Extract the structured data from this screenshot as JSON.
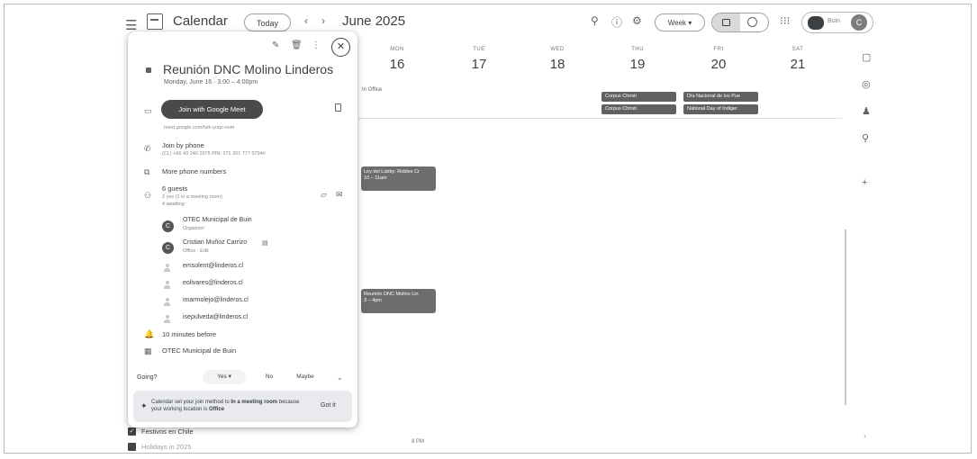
{
  "header": {
    "app_title": "Calendar",
    "today_label": "Today",
    "prev": "‹",
    "next": "›",
    "month": "June 2025",
    "view_label": "Week",
    "org_name": "Buin",
    "avatar_initial": "C"
  },
  "days": [
    {
      "name": "MON",
      "num": "16"
    },
    {
      "name": "TUE",
      "num": "17"
    },
    {
      "name": "WED",
      "num": "18"
    },
    {
      "name": "THU",
      "num": "19"
    },
    {
      "name": "FRI",
      "num": "20"
    },
    {
      "name": "SAT",
      "num": "21"
    }
  ],
  "working_location": "In Office",
  "allday_events": {
    "thu_1": "Corpus Christi",
    "thu_2": "Corpus Christi",
    "fri_1": "Día Nacional de los Pue",
    "fri_2": "National Day of Indiger"
  },
  "events": {
    "e1_title": "Ley del Lobby: Robles Cr",
    "e1_time": "10 – 11am",
    "e2_title": "Reunión DNC Molino Lin",
    "e2_time": "3 – 4pm"
  },
  "grid": {
    "bottom_time": "8 PM"
  },
  "calendars": {
    "item1": "Festivos en Chile",
    "item2": "Holidays in 2025"
  },
  "popup": {
    "title": "Reunión DNC Molino Linderos",
    "when": "Monday, June 16  ·  3:00 – 4:00pm",
    "join_button": "Join with Google Meet",
    "meet_link": "meet.google.com/hzk-yuqv-nom",
    "phone_label": "Join by phone",
    "phone_detail": "(CL) +56 43 240 2075 PIN: 271 201 777 0794#",
    "more_phones": "More phone numbers",
    "guests_count": "6 guests",
    "guests_summary": "2 yes (1 in a meeting room)",
    "guests_awaiting": "4 awaiting",
    "guests": [
      {
        "name": "OTEC Municipal de Buin",
        "sub": "Organizer"
      },
      {
        "name": "Cristian Muñoz Carrizo",
        "sub": "Office · Edit"
      },
      {
        "name": "emsolent@linderos.cl"
      },
      {
        "name": "eolivares@linderos.cl"
      },
      {
        "name": "imarmolejo@linderos.cl"
      },
      {
        "name": "isepulveda@linderos.cl"
      }
    ],
    "reminder": "10 minutes before",
    "calendar_owner": "OTEC Municipal de Buin",
    "going_label": "Going?",
    "rsvp_yes": "Yes",
    "rsvp_no": "No",
    "rsvp_maybe": "Maybe",
    "tip_part1": "Calendar set your join method to",
    "tip_bold1": "In a meeting room",
    "tip_part2": "because your working location is",
    "tip_bold2": "Office",
    "got_it": "Got it"
  }
}
